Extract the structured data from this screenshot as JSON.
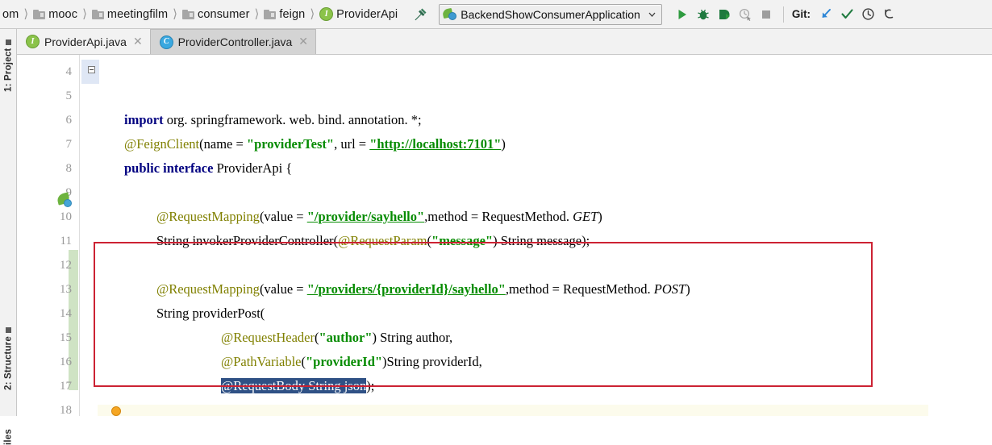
{
  "window": {
    "app": "IntelliJ IDEA",
    "file": "ProviderApi.java"
  },
  "navbar": {
    "breadcrumbs": [
      {
        "label": "om",
        "icon": "folder-icon"
      },
      {
        "label": "mooc",
        "icon": "folder-icon"
      },
      {
        "label": "meetingfilm",
        "icon": "folder-icon"
      },
      {
        "label": "consumer",
        "icon": "folder-icon"
      },
      {
        "label": "feign",
        "icon": "folder-icon"
      },
      {
        "label": "ProviderApi",
        "icon": "interface-icon"
      }
    ],
    "build_icon": "hammer-icon",
    "run_config": {
      "name": "BackendShowConsumerApplication",
      "icon": "spring-boot-icon",
      "dropdown_icon": "chevron-down-icon"
    },
    "buttons": [
      {
        "name": "run-button",
        "icon": "play-icon",
        "color": "#2e9b3f"
      },
      {
        "name": "debug-button",
        "icon": "bug-icon",
        "color": "#1f7a3f"
      },
      {
        "name": "run-with-coverage-button",
        "icon": "run-coverage-icon",
        "color": "#1f7a3f"
      },
      {
        "name": "profile-button",
        "icon": "profiler-icon",
        "color": "#a8a8a8"
      },
      {
        "name": "stop-button",
        "icon": "stop-icon",
        "color": "#9d9d9d"
      }
    ],
    "git": {
      "label": "Git:",
      "buttons": [
        {
          "name": "update-project-button",
          "icon": "arrow-down-left-icon",
          "color": "#2d86d6"
        },
        {
          "name": "commit-button",
          "icon": "checkmark-icon",
          "color": "#1f7a3f"
        },
        {
          "name": "history-button",
          "icon": "clock-icon",
          "color": "#3c3c3c"
        },
        {
          "name": "rollback-button",
          "icon": "undo-arrow-icon",
          "color": "#3c3c3c"
        }
      ]
    }
  },
  "left_stripe": {
    "buttons": [
      {
        "label": "1: Project"
      },
      {
        "label": "2: Structure"
      },
      {
        "label": "iles"
      }
    ]
  },
  "tabs": [
    {
      "label": "ProviderApi.java",
      "icon": "interface-icon",
      "active": false,
      "close_icon": "close-icon"
    },
    {
      "label": "ProviderController.java",
      "icon": "class-icon",
      "active": true,
      "close_icon": "close-icon"
    }
  ],
  "editor": {
    "first_line_number": 4,
    "line_numbers": [
      4,
      5,
      6,
      7,
      8,
      9,
      10,
      11,
      12,
      13,
      14,
      15,
      16,
      17,
      18
    ],
    "gutter_icons": [
      {
        "name": "spring-bean-icon",
        "line": 7
      },
      {
        "name": "intention-bulb-icon",
        "line": 16
      }
    ],
    "lines": [
      {
        "n": 4,
        "text": "import org. springframework. web. bind. annotation. *;"
      },
      {
        "n": 5,
        "text": ""
      },
      {
        "n": 6,
        "text": "@FeignClient(name = \"providerTest\", url = \"http://localhost:7101\")"
      },
      {
        "n": 7,
        "text": "public interface ProviderApi {"
      },
      {
        "n": 8,
        "text": ""
      },
      {
        "n": 9,
        "text": "    @RequestMapping(value = \"/provider/sayhello\",method = RequestMethod. GET)"
      },
      {
        "n": 10,
        "text": "    String invokerProviderController(@RequestParam(\"message\") String message);"
      },
      {
        "n": 11,
        "text": ""
      },
      {
        "n": 12,
        "text": "    @RequestMapping(value = \"/providers/{providerId}/sayhello\",method = RequestMethod. POST)"
      },
      {
        "n": 13,
        "text": "    String providerPost("
      },
      {
        "n": 14,
        "text": "            @RequestHeader(\"author\") String author,"
      },
      {
        "n": 15,
        "text": "            @PathVariable(\"providerId\")String providerId,"
      },
      {
        "n": 16,
        "text": "            @RequestBody String json);"
      },
      {
        "n": 17,
        "text": ""
      },
      {
        "n": 18,
        "text": "}"
      }
    ],
    "tokens": {
      "l4": {
        "kw": "import",
        "rest": "org. springframework. web. bind. annotation. *;"
      },
      "l6": {
        "ann": "@FeignClient",
        "p1": "(name = ",
        "s1": "\"providerTest\"",
        "p2": ", url = ",
        "s2": "\"http://localhost:7101\"",
        "p3": ")"
      },
      "l7": {
        "kw1": "public",
        "kw2": "interface",
        "name": "ProviderApi",
        "brace": "{"
      },
      "l9": {
        "ann": "@RequestMapping",
        "p1": "(value = ",
        "s1": "\"/provider/sayhello\"",
        "p2": ",method = RequestMethod. ",
        "em": "GET",
        "p3": ")"
      },
      "l10": {
        "p1": "String invokerProviderController(",
        "ann": "@RequestParam",
        "p2": "(",
        "s1": "\"message\"",
        "p3": ") String message);"
      },
      "l12": {
        "ann": "@RequestMapping",
        "p1": "(value = ",
        "s1": "\"/providers/{providerId}/sayhello\"",
        "p2": ",method = RequestMethod. ",
        "em": "POST",
        "p3": ")"
      },
      "l13": {
        "p1": "String providerPost("
      },
      "l14": {
        "ann": "@RequestHeader",
        "p1": "(",
        "s1": "\"author\"",
        "p2": ") String author,"
      },
      "l15": {
        "ann": "@PathVariable",
        "p1": "(",
        "s1": "\"providerId\"",
        "p2": ")String providerId,"
      },
      "l16": {
        "sel": "@RequestBody String json",
        "p1": ");"
      },
      "l18": {
        "p1": "}"
      }
    },
    "selection_text": "@RequestBody String json",
    "colors": {
      "keyword": "#000080",
      "annotation": "#808000",
      "string": "#058b00",
      "selection_bg": "#2f5185",
      "caret_line_bg": "#fcfbec",
      "vcs_changed": "#cfe3c4",
      "annotation_box": "#cc2233"
    }
  },
  "annotation": {
    "name": "red-highlight-rectangle",
    "color": "#cc2233"
  }
}
